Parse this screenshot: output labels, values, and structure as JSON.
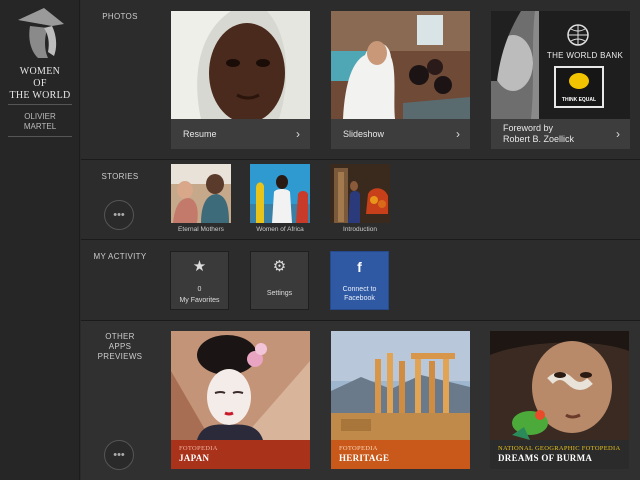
{
  "brand": {
    "title_line1": "WOMEN",
    "title_line2": "OF",
    "title_line3": "THE WORLD",
    "author_line1": "OLIVIER",
    "author_line2": "MARTEL"
  },
  "photos": {
    "label": "PHOTOS",
    "cards": [
      {
        "caption": "Resume",
        "icon": "chevron-right-icon"
      },
      {
        "caption": "Slideshow",
        "icon": "chevron-right-icon"
      },
      {
        "caption_line1": "Foreword by",
        "caption_line2": "Robert B. Zoellick",
        "icon": "chevron-right-icon",
        "badge_title": "THE WORLD BANK",
        "badge_sign": "THINK EQUAL"
      }
    ]
  },
  "stories": {
    "label": "STORIES",
    "more": "•••",
    "items": [
      {
        "label": "Eternal Mothers"
      },
      {
        "label": "Women of Africa"
      },
      {
        "label": "Introduction"
      }
    ]
  },
  "activity": {
    "label": "MY ACTIVITY",
    "tiles": [
      {
        "icon": "star-icon",
        "count": "0",
        "label": "My Favorites"
      },
      {
        "icon": "gear-icon",
        "label": "Settings"
      },
      {
        "icon": "facebook-icon",
        "label_line1": "Connect to",
        "label_line2": "Facebook"
      }
    ]
  },
  "apps": {
    "label_line1": "OTHER",
    "label_line2": "APPS",
    "label_line3": "PREVIEWS",
    "more": "•••",
    "cards": [
      {
        "brand": "FOTOPEDIA",
        "name": "JAPAN",
        "color": "#a8321a"
      },
      {
        "brand": "FOTOPEDIA",
        "name": "HERITAGE",
        "color": "#c9591a"
      },
      {
        "brand": "NATIONAL GEOGRAPHIC FOTOPEDIA",
        "name": "DREAMS OF BURMA",
        "color": "#2b2b2b"
      }
    ]
  }
}
